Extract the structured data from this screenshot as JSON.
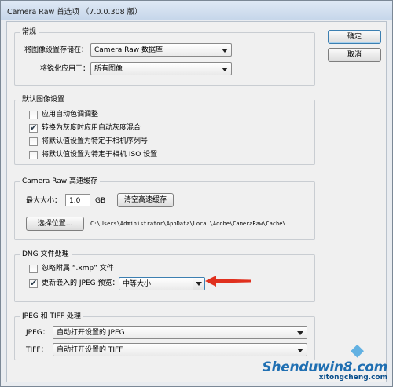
{
  "window": {
    "title": "Camera Raw 首选项  （7.0.0.308 版）"
  },
  "buttons": {
    "ok": "确定",
    "cancel": "取消"
  },
  "general": {
    "legend": "常规",
    "save_settings_label": "将图像设置存储在：",
    "save_settings_value": "Camera Raw 数据库",
    "apply_sharpening_label": "将锐化应用于：",
    "apply_sharpening_value": "所有图像"
  },
  "default_settings": {
    "legend": "默认图像设置",
    "options": [
      {
        "label": "应用自动色调调整",
        "checked": false
      },
      {
        "label": "转换为灰度时应用自动灰度混合",
        "checked": true
      },
      {
        "label": "将默认值设置为特定于相机序列号",
        "checked": false
      },
      {
        "label": "将默认值设置为特定于相机 ISO 设置",
        "checked": false
      }
    ]
  },
  "cache": {
    "legend": "Camera Raw 高速缓存",
    "max_size_label": "最大大小：",
    "max_size_value": "1.0",
    "unit": "GB",
    "purge_button": "清空高速缓存",
    "location_button": "选择位置...",
    "path": "C:\\Users\\Administrator\\AppData\\Local\\Adobe\\CameraRaw\\Cache\\"
  },
  "dng": {
    "legend": "DNG 文件处理",
    "ignore_xmp_label": "忽略附属 “.xmp” 文件",
    "ignore_xmp_checked": false,
    "update_jpeg_label": "更新嵌入的 JPEG 预览：",
    "update_jpeg_checked": true,
    "preview_size_value": "中等大小"
  },
  "jpeg_tiff": {
    "legend": "JPEG 和 TIFF 处理",
    "jpeg_label": "JPEG：",
    "jpeg_value": "自动打开设置的 JPEG",
    "tiff_label": "TIFF：",
    "tiff_value": "自动打开设置的 TIFF"
  },
  "watermark": {
    "brand": "Shenduwin8.com",
    "domain": "xitongcheng.com"
  },
  "colors": {
    "annotation_arrow": "#e0301e",
    "focus_border": "#3c7fb1"
  }
}
